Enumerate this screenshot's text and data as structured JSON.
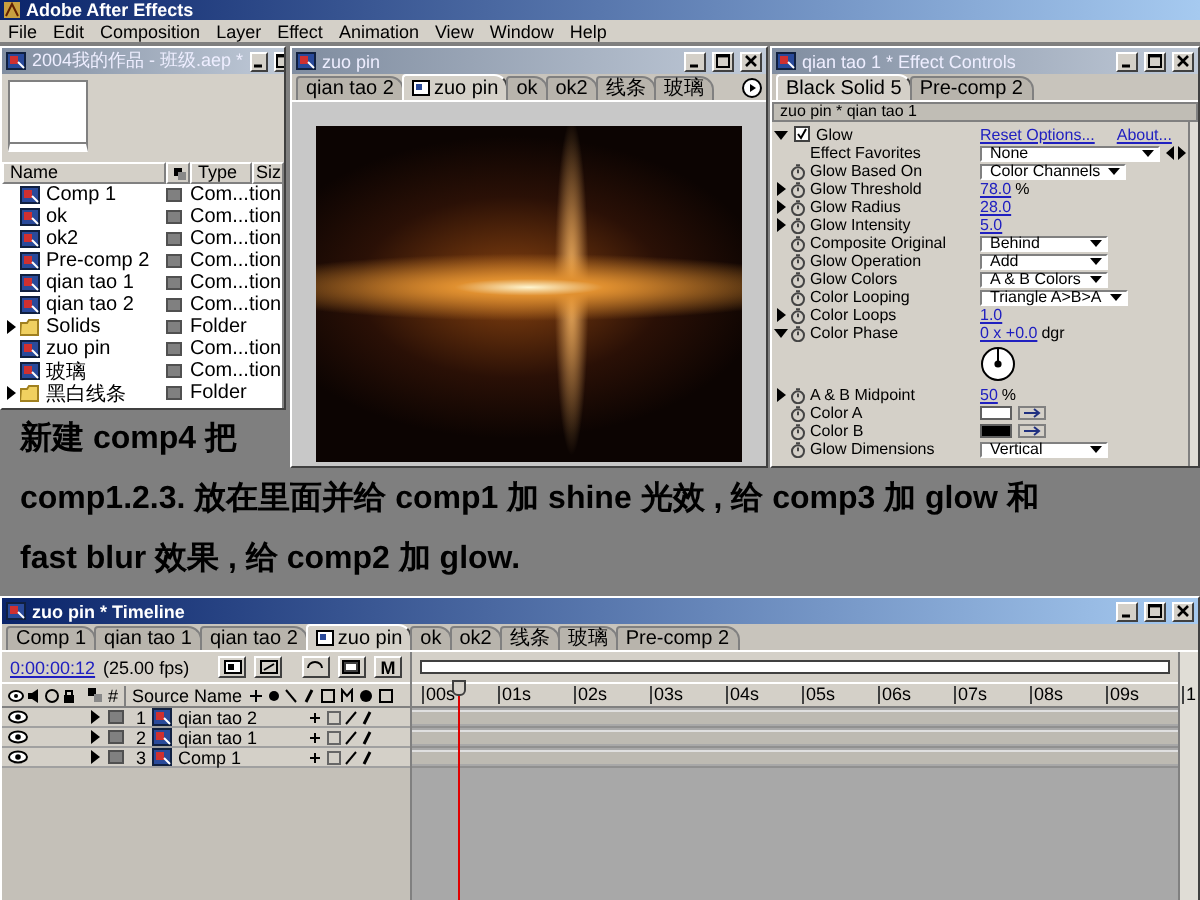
{
  "app": {
    "title": "Adobe After Effects",
    "menu": [
      "File",
      "Edit",
      "Composition",
      "Layer",
      "Effect",
      "Animation",
      "View",
      "Window",
      "Help"
    ]
  },
  "project": {
    "title": "2004我的作品 - 班级.aep *",
    "columns": [
      "Name",
      "Type",
      "Siz"
    ],
    "items": [
      {
        "kind": "comp",
        "name": "Comp 1",
        "type": "Com...tion"
      },
      {
        "kind": "comp",
        "name": "ok",
        "type": "Com...tion"
      },
      {
        "kind": "comp",
        "name": "ok2",
        "type": "Com...tion"
      },
      {
        "kind": "comp",
        "name": "Pre-comp 2",
        "type": "Com...tion"
      },
      {
        "kind": "comp",
        "name": "qian tao 1",
        "type": "Com...tion"
      },
      {
        "kind": "comp",
        "name": "qian tao 2",
        "type": "Com...tion"
      },
      {
        "kind": "folder",
        "name": "Solids",
        "type": "Folder",
        "expanded": false
      },
      {
        "kind": "comp",
        "name": "zuo pin",
        "type": "Com...tion"
      },
      {
        "kind": "comp",
        "name": "玻璃",
        "type": "Com...tion"
      },
      {
        "kind": "folder",
        "name": "黑白线条",
        "type": "Folder",
        "expanded": false
      }
    ]
  },
  "viewer": {
    "title": "zuo pin",
    "tabs": [
      {
        "label": "qian tao 2",
        "selected": false
      },
      {
        "label": "zuo pin",
        "selected": true
      },
      {
        "label": "ok",
        "selected": false
      },
      {
        "label": "ok2",
        "selected": false
      },
      {
        "label": "线条",
        "selected": false
      },
      {
        "label": "玻璃",
        "selected": false
      }
    ]
  },
  "effect_controls": {
    "title": "qian tao 1 * Effect Controls",
    "tabs": [
      {
        "label": "Black Solid 5",
        "selected": true
      },
      {
        "label": "Pre-comp 2",
        "selected": false
      }
    ],
    "layer_path": "zuo pin * qian tao 1",
    "effect": {
      "name": "Glow",
      "expanded": true,
      "enabled": true,
      "reset": "Reset Options...",
      "about": "About..."
    },
    "properties": [
      {
        "kind": "favorites",
        "name": "Effect Favorites",
        "value": "None"
      },
      {
        "kind": "dropdown",
        "name": "Glow Based On",
        "value": "Color Channels"
      },
      {
        "kind": "number",
        "name": "Glow Threshold",
        "value": "78.0",
        "unit": "%",
        "expanded": false
      },
      {
        "kind": "number",
        "name": "Glow Radius",
        "value": "28.0",
        "expanded": false
      },
      {
        "kind": "number",
        "name": "Glow Intensity",
        "value": "5.0",
        "expanded": false
      },
      {
        "kind": "dropdown",
        "name": "Composite Original",
        "value": "Behind"
      },
      {
        "kind": "dropdown",
        "name": "Glow Operation",
        "value": "Add"
      },
      {
        "kind": "dropdown",
        "name": "Glow Colors",
        "value": "A & B Colors"
      },
      {
        "kind": "dropdown",
        "name": "Color Looping",
        "value": "Triangle A>B>A"
      },
      {
        "kind": "number",
        "name": "Color Loops",
        "value": "1.0",
        "expanded": false
      },
      {
        "kind": "angle",
        "name": "Color Phase",
        "value": "0 x +0.0",
        "unit": "dgr",
        "expanded": true
      },
      {
        "kind": "number",
        "name": "A & B Midpoint",
        "value": "50",
        "unit": "%",
        "expanded": false
      },
      {
        "kind": "color",
        "name": "Color A",
        "color": "#ffffff"
      },
      {
        "kind": "color",
        "name": "Color B",
        "color": "#000000"
      },
      {
        "kind": "dropdown",
        "name": "Glow Dimensions",
        "value": "Vertical"
      }
    ]
  },
  "caption": [
    "新建 comp4 把",
    "comp1.2.3. 放在里面并给 comp1 加 shine 光效 , 给 comp3 加 glow 和",
    "fast blur 效果 , 给 comp2 加 glow."
  ],
  "timeline": {
    "title": "zuo pin * Timeline",
    "tabs": [
      {
        "label": "Comp 1",
        "selected": false
      },
      {
        "label": "qian tao 1",
        "selected": false
      },
      {
        "label": "qian tao 2",
        "selected": false
      },
      {
        "label": "zuo pin",
        "selected": true
      },
      {
        "label": "ok",
        "selected": false
      },
      {
        "label": "ok2",
        "selected": false
      },
      {
        "label": "线条",
        "selected": false
      },
      {
        "label": "玻璃",
        "selected": false
      },
      {
        "label": "Pre-comp 2",
        "selected": false
      }
    ],
    "current_time": "0:00:00:12",
    "fps": "(25.00 fps)",
    "motion_blur_label": "M",
    "columns": {
      "number": "#",
      "source_name": "Source Name"
    },
    "layers": [
      {
        "number": "1",
        "name": "qian tao 2",
        "visible": true
      },
      {
        "number": "2",
        "name": "qian tao 1",
        "visible": true
      },
      {
        "number": "3",
        "name": "Comp 1",
        "visible": true
      }
    ],
    "ruler": [
      "00s",
      "01s",
      "02s",
      "03s",
      "04s",
      "05s",
      "06s",
      "07s",
      "08s",
      "09s",
      "1"
    ],
    "playhead": {
      "level": 0.048
    }
  }
}
